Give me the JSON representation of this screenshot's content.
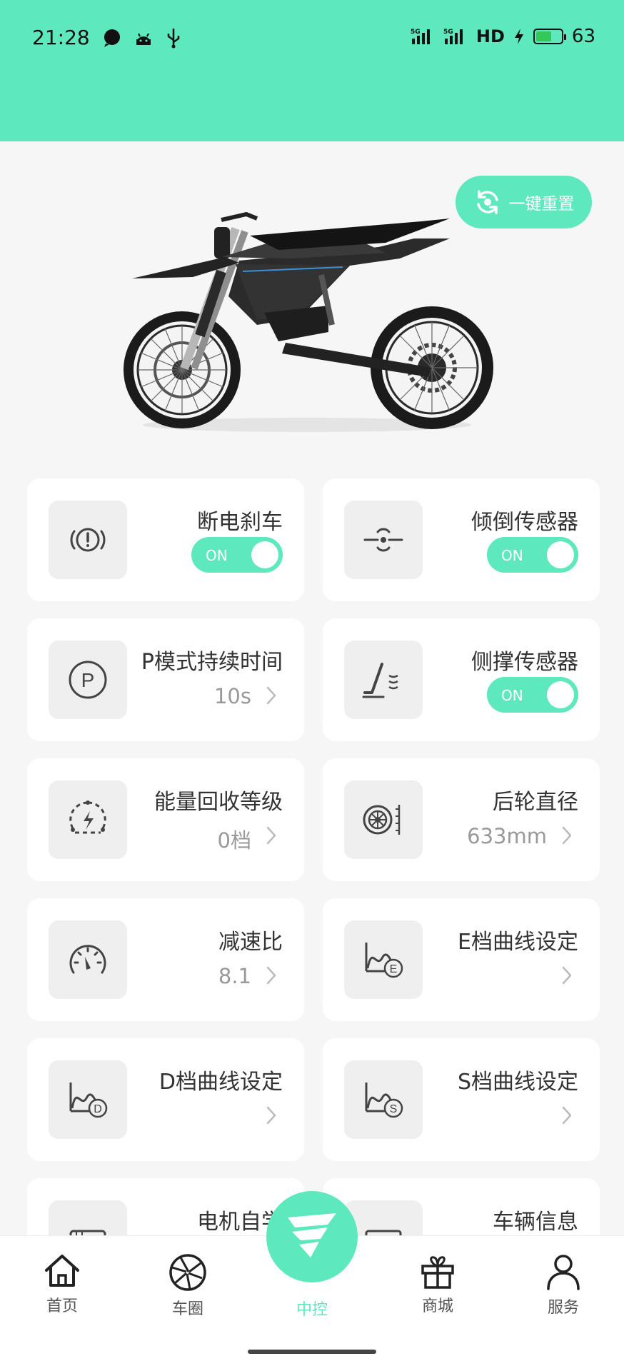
{
  "status_bar": {
    "time": "21:28",
    "network": "HD",
    "battery": "63",
    "battery_level": 0.63
  },
  "reset_button": {
    "label": "一键重置"
  },
  "image": {
    "name": "motorcycle-image"
  },
  "cards": [
    {
      "name": "power-off-brake",
      "title": "断电刹车",
      "toggle": "ON",
      "icon": "brake-warning-icon"
    },
    {
      "name": "tilt-sensor",
      "title": "倾倒传感器",
      "toggle": "ON",
      "icon": "tilt-sensor-icon"
    },
    {
      "name": "p-mode-duration",
      "title": "P模式持续时间",
      "value": "10s",
      "icon": "parking-icon"
    },
    {
      "name": "kickstand-sensor",
      "title": "侧撑传感器",
      "toggle": "ON",
      "icon": "kickstand-icon"
    },
    {
      "name": "energy-recovery-level",
      "title": "能量回收等级",
      "value": "0档",
      "icon": "energy-recovery-icon"
    },
    {
      "name": "rear-wheel-diameter",
      "title": "后轮直径",
      "value": "633mm",
      "icon": "wheel-icon"
    },
    {
      "name": "reduction-ratio",
      "title": "减速比",
      "value": "8.1",
      "icon": "speedometer-icon"
    },
    {
      "name": "e-gear-curve",
      "title": "E档曲线设定",
      "value": "",
      "icon": "curve-e-icon"
    },
    {
      "name": "d-gear-curve",
      "title": "D档曲线设定",
      "value": "",
      "icon": "curve-d-icon"
    },
    {
      "name": "s-gear-curve",
      "title": "S档曲线设定",
      "value": "",
      "icon": "curve-s-icon"
    },
    {
      "name": "motor-self-learning",
      "title": "电机自学",
      "value": "",
      "icon": "motor-icon"
    },
    {
      "name": "vehicle-info",
      "title": "车辆信息",
      "value": "",
      "icon": "vehicle-info-icon"
    }
  ],
  "tabbar": {
    "home": "首页",
    "circle": "车圈",
    "control": "中控",
    "mall": "商城",
    "service": "服务"
  }
}
